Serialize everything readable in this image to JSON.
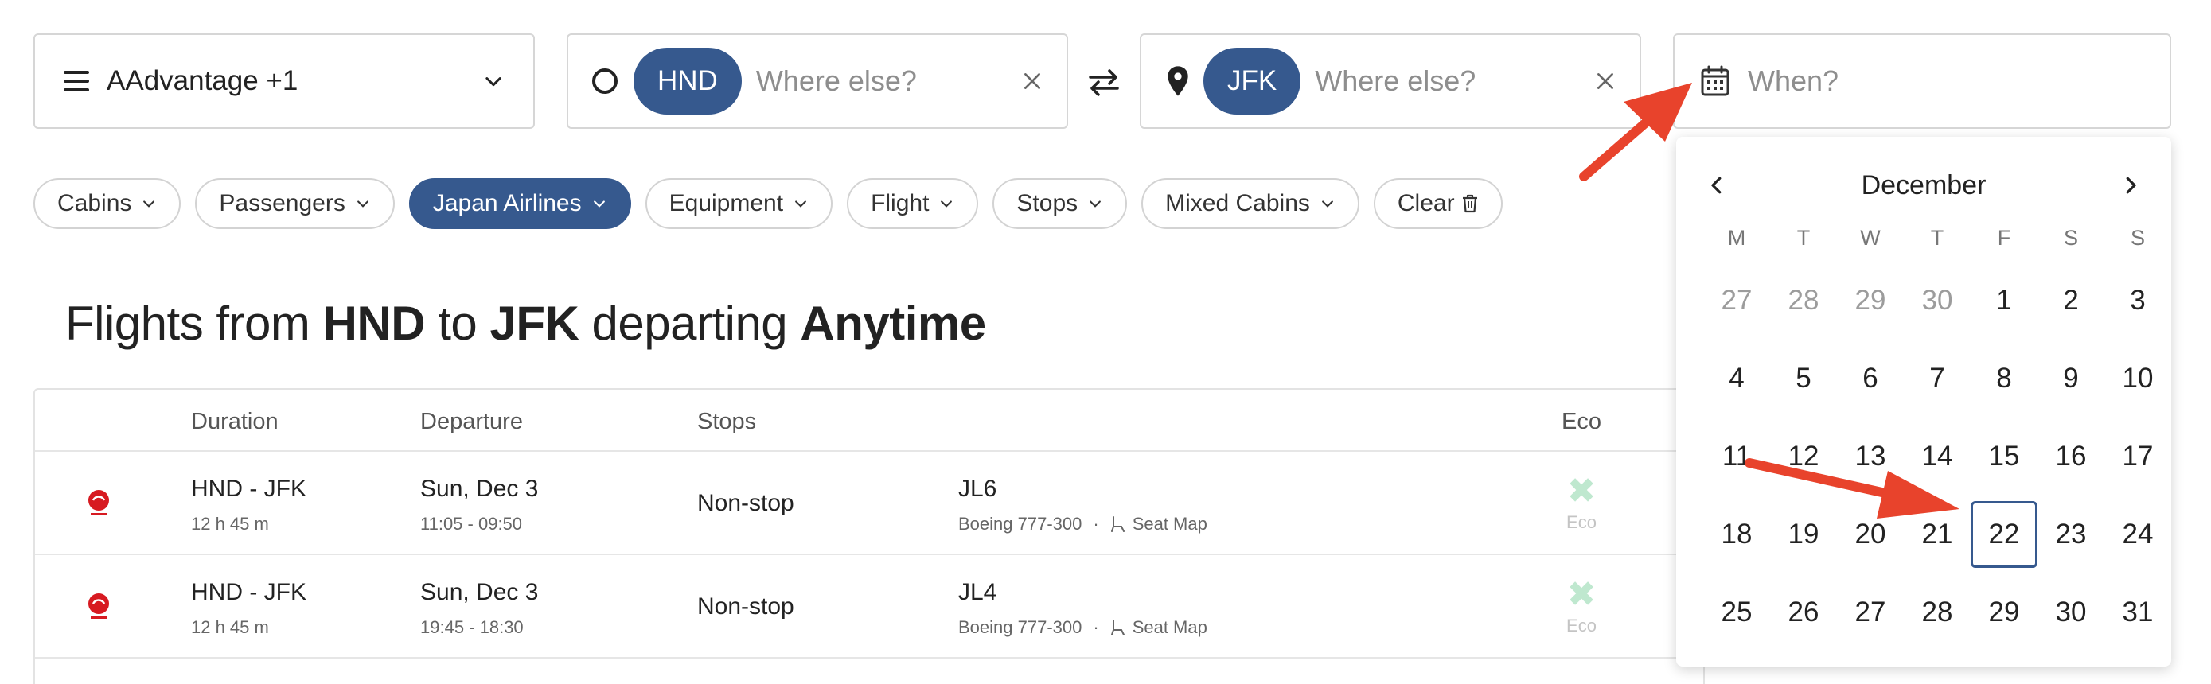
{
  "search": {
    "program_label": "AAdvantage +1",
    "origin_code": "HND",
    "origin_placeholder": "Where else?",
    "dest_code": "JFK",
    "dest_placeholder": "Where else?",
    "when_placeholder": "When?"
  },
  "filters": [
    {
      "label": "Cabins",
      "active": false
    },
    {
      "label": "Passengers",
      "active": false
    },
    {
      "label": "Japan Airlines",
      "active": true
    },
    {
      "label": "Equipment",
      "active": false
    },
    {
      "label": "Flight",
      "active": false
    },
    {
      "label": "Stops",
      "active": false
    },
    {
      "label": "Mixed Cabins",
      "active": false
    },
    {
      "label": "Clear",
      "active": false
    }
  ],
  "heading": {
    "prefix": "Flights from",
    "from": "HND",
    "to_word": "to",
    "to": "JFK",
    "departing_word": "departing",
    "when": "Anytime"
  },
  "table": {
    "headers": [
      "Duration",
      "Departure",
      "Stops",
      "Eco"
    ],
    "rows": [
      {
        "route": "HND - JFK",
        "duration": "12 h 45 m",
        "date": "Sun, Dec 3",
        "times": "11:05 - 09:50",
        "stops": "Non-stop",
        "flight": "JL6",
        "aircraft": "Boeing 777-300",
        "seat_map": "Seat Map",
        "eco": "Eco"
      },
      {
        "route": "HND - JFK",
        "duration": "12 h 45 m",
        "date": "Sun, Dec 3",
        "times": "19:45 - 18:30",
        "stops": "Non-stop",
        "flight": "JL4",
        "aircraft": "Boeing 777-300",
        "seat_map": "Seat Map",
        "eco": "Eco"
      }
    ]
  },
  "calendar": {
    "month": "December",
    "weekdays": [
      "M",
      "T",
      "W",
      "T",
      "F",
      "S",
      "S"
    ],
    "weeks": [
      [
        {
          "d": "27",
          "muted": true
        },
        {
          "d": "28",
          "muted": true
        },
        {
          "d": "29",
          "muted": true
        },
        {
          "d": "30",
          "muted": true
        },
        {
          "d": "1"
        },
        {
          "d": "2"
        },
        {
          "d": "3"
        }
      ],
      [
        {
          "d": "4"
        },
        {
          "d": "5"
        },
        {
          "d": "6"
        },
        {
          "d": "7"
        },
        {
          "d": "8"
        },
        {
          "d": "9"
        },
        {
          "d": "10"
        }
      ],
      [
        {
          "d": "11"
        },
        {
          "d": "12"
        },
        {
          "d": "13"
        },
        {
          "d": "14"
        },
        {
          "d": "15"
        },
        {
          "d": "16"
        },
        {
          "d": "17"
        }
      ],
      [
        {
          "d": "18"
        },
        {
          "d": "19"
        },
        {
          "d": "20"
        },
        {
          "d": "21"
        },
        {
          "d": "22",
          "selected": true
        },
        {
          "d": "23"
        },
        {
          "d": "24"
        }
      ],
      [
        {
          "d": "25"
        },
        {
          "d": "26"
        },
        {
          "d": "27"
        },
        {
          "d": "28"
        },
        {
          "d": "29"
        },
        {
          "d": "30"
        },
        {
          "d": "31"
        }
      ]
    ]
  },
  "colors": {
    "accent": "#36598e",
    "annotation_arrow": "#e8432c",
    "eco_mark": "#bfe8cf"
  }
}
